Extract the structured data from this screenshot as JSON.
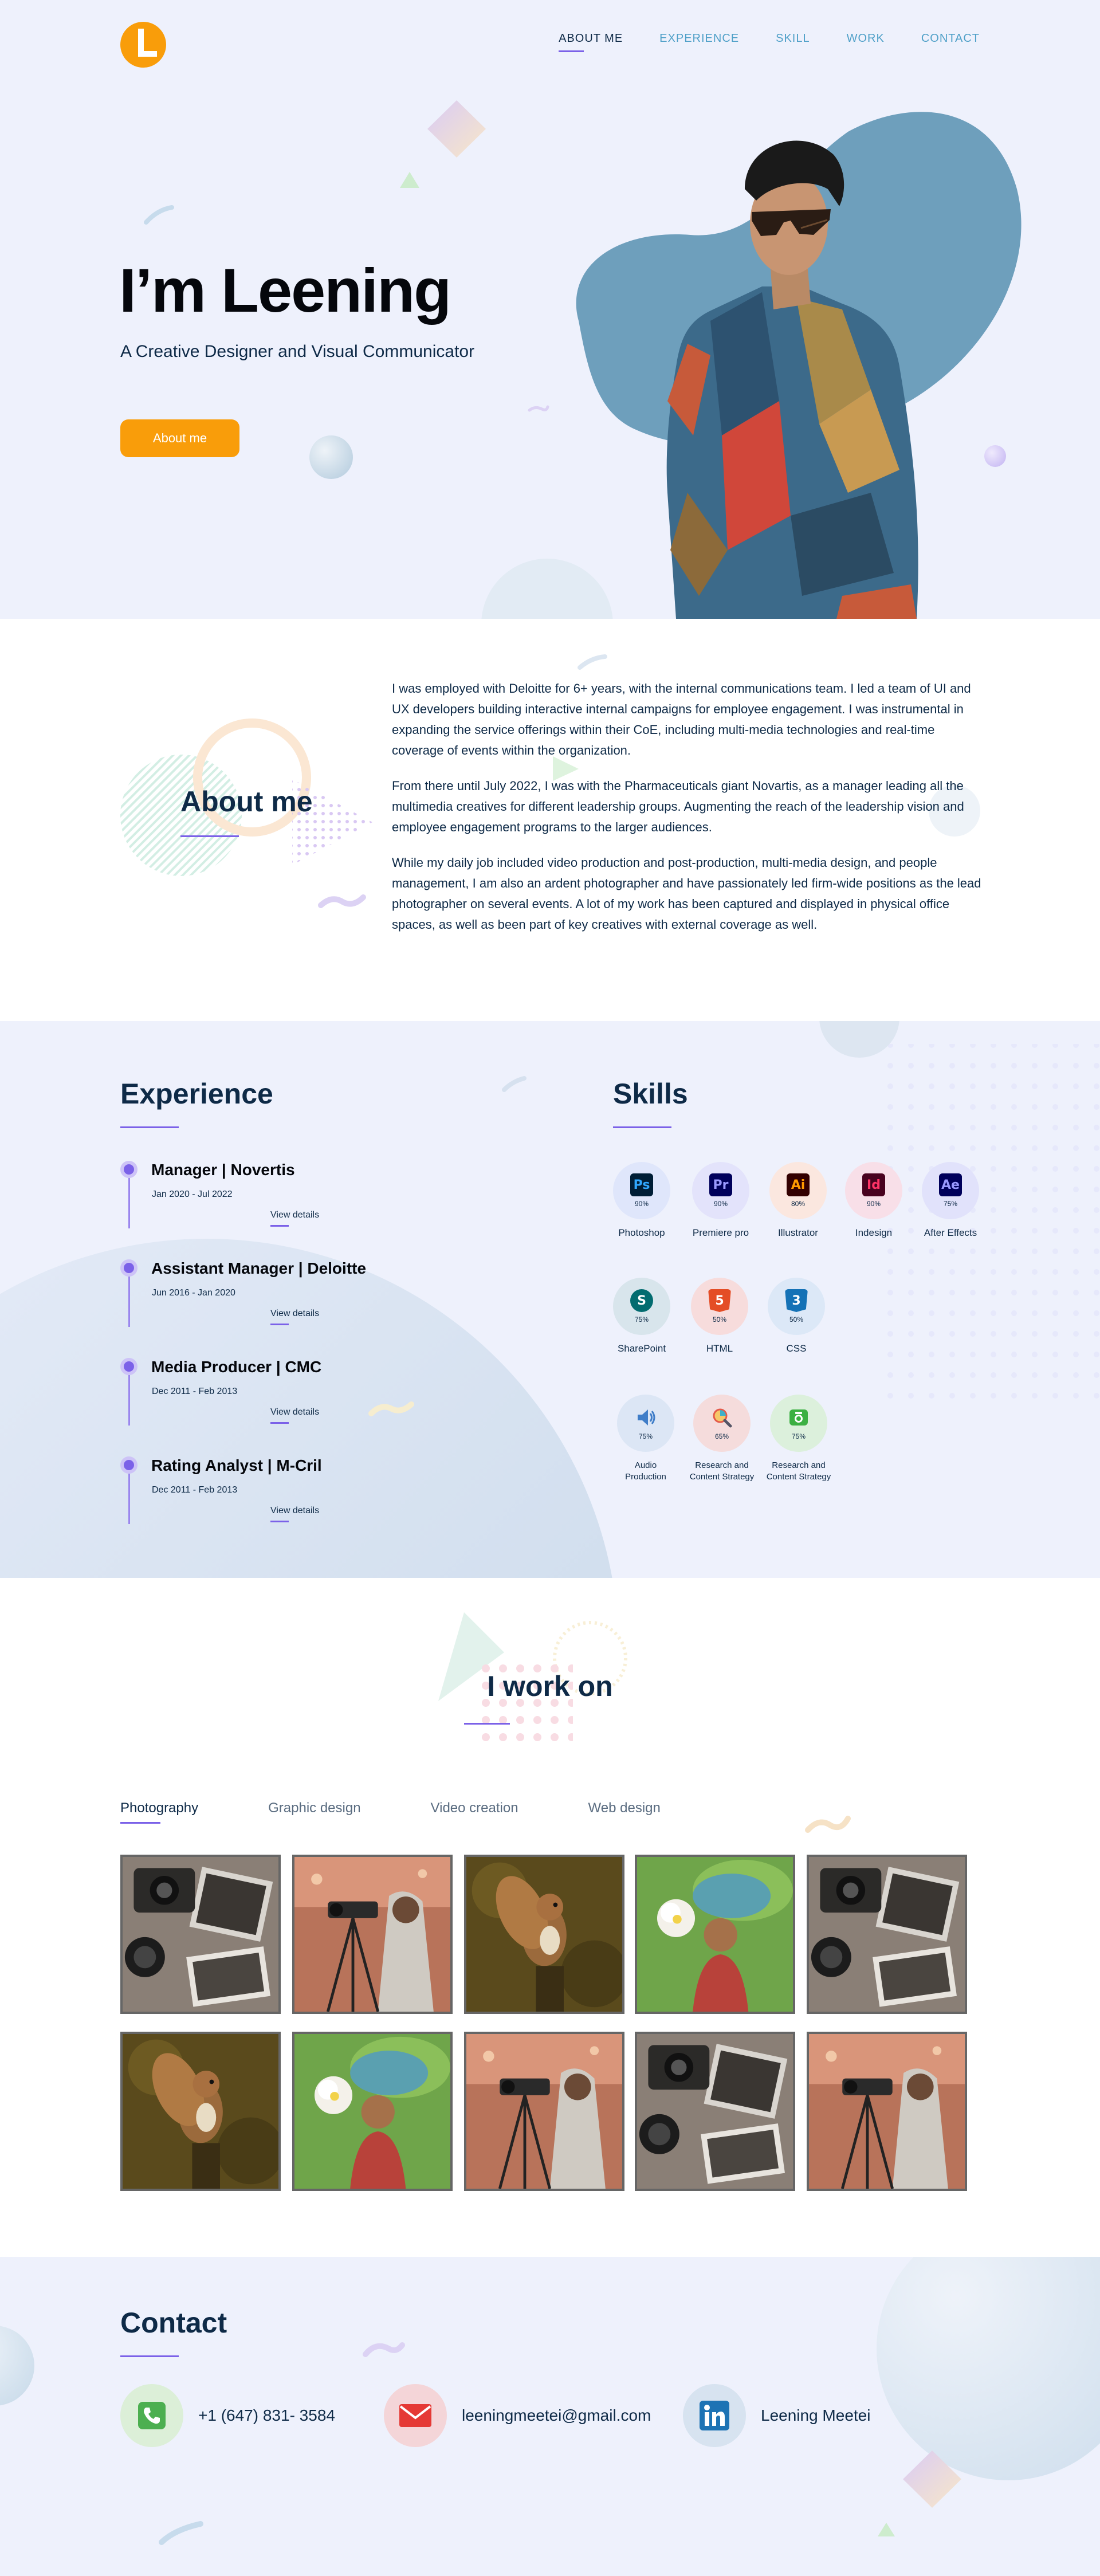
{
  "nav": {
    "items": [
      "ABOUT ME",
      "EXPERIENCE",
      "SKILL",
      "WORK",
      "CONTACT"
    ]
  },
  "hero": {
    "title": "I’m Leening",
    "subtitle": "A Creative Designer and Visual Communicator",
    "cta": "About me"
  },
  "about": {
    "title": "About me",
    "paragraphs": [
      "I was employed with Deloitte for 6+ years, with the internal communications team. I led a team of UI and UX developers building interactive internal campaigns for employee engagement. I was instrumental in expanding the service offerings within their CoE, including multi-media technologies and real-time coverage of events within the organization.",
      "From there until July 2022, I was with the Pharmaceuticals giant Novartis, as a manager leading all the multimedia creatives for different leadership groups. Augmenting the reach of the leadership vision and employee engagement programs to the larger audiences.",
      "While my daily job included video production and post-production, multi-media design, and people management, I am also an ardent photographer and have passionately led firm-wide positions as the lead photographer on several events. A lot of my work has been captured and displayed in physical office spaces, as well as been part of key creatives with external coverage as well."
    ]
  },
  "experience": {
    "title": "Experience",
    "items": [
      {
        "title": "Manager | Novertis",
        "date": "Jan 2020 - Jul 2022",
        "link": "View details"
      },
      {
        "title": "Assistant Manager | Deloitte",
        "date": "Jun 2016 - Jan 2020",
        "link": "View details"
      },
      {
        "title": "Media Producer | CMC",
        "date": "Dec 2011 - Feb 2013",
        "link": "View details"
      },
      {
        "title": "Rating Analyst | M-Cril",
        "date": "Dec 2011 - Feb 2013",
        "link": "View details"
      }
    ]
  },
  "skills": {
    "title": "Skills",
    "items": [
      {
        "name": "Photoshop",
        "pct": "90%",
        "icon": "Ps",
        "bg": "#dfe6fb",
        "icon_bg": "#001e36",
        "icon_fg": "#31a8ff"
      },
      {
        "name": "Premiere pro",
        "pct": "90%",
        "icon": "Pr",
        "bg": "#e3e3fb",
        "icon_bg": "#00005b",
        "icon_fg": "#9999ff"
      },
      {
        "name": "Illustrator",
        "pct": "80%",
        "icon": "Ai",
        "bg": "#fbe7df",
        "icon_bg": "#330000",
        "icon_fg": "#ff9a00"
      },
      {
        "name": "Indesign",
        "pct": "90%",
        "icon": "Id",
        "bg": "#f8dfe8",
        "icon_bg": "#49021f",
        "icon_fg": "#ff3366"
      },
      {
        "name": "After Effects",
        "pct": "75%",
        "icon": "Ae",
        "bg": "#e1e2fb",
        "icon_bg": "#00005b",
        "icon_fg": "#9999ff"
      },
      {
        "name": "SharePoint",
        "pct": "75%",
        "icon": "S",
        "bg": "#d8e5ec",
        "icon_bg": "#036c70",
        "icon_fg": "#ffffff"
      },
      {
        "name": "HTML",
        "pct": "50%",
        "icon": "5",
        "bg": "#f7dcdc",
        "icon_bg": "#e44d26",
        "icon_fg": "#ffffff"
      },
      {
        "name": "CSS",
        "pct": "50%",
        "icon": "3",
        "bg": "#dce8f7",
        "icon_bg": "#1572b6",
        "icon_fg": "#ffffff"
      },
      {
        "name": "Audio Production",
        "pct": "75%",
        "icon": "speaker-icon",
        "bg": "#dce6f5",
        "icon_bg": "transparent",
        "icon_fg": "#3f7dc8"
      },
      {
        "name": "Research and Content Strategy",
        "pct": "65%",
        "icon": "magnifier-icon",
        "bg": "#f5dcdc",
        "icon_bg": "transparent",
        "icon_fg": "#e45a4a"
      },
      {
        "name": "Research and Content Strategy",
        "pct": "75%",
        "icon": "camera-icon",
        "bg": "#dcf0dc",
        "icon_bg": "transparent",
        "icon_fg": "#3cb043"
      }
    ]
  },
  "work": {
    "title": "I work on",
    "tabs": [
      "Photography",
      "Graphic design",
      "Video creation",
      "Web design"
    ],
    "thumbs": [
      "camera-flatlay",
      "woman-camera",
      "squirrel",
      "girl-flower",
      "camera-flatlay",
      "squirrel",
      "girl-flower",
      "woman-camera",
      "camera-flatlay",
      "woman-camera"
    ]
  },
  "contact": {
    "title": "Contact",
    "phone": "+1 (647) 831- 3584",
    "email": "leeningmeetei@gmail.com",
    "linkedin": "Leening Meetei"
  },
  "colors": {
    "accent": "#7b61e8",
    "orange": "#f99d0a",
    "navy": "#0e2a47",
    "link": "#4fa0c8",
    "blob": "#6e9fbc"
  }
}
